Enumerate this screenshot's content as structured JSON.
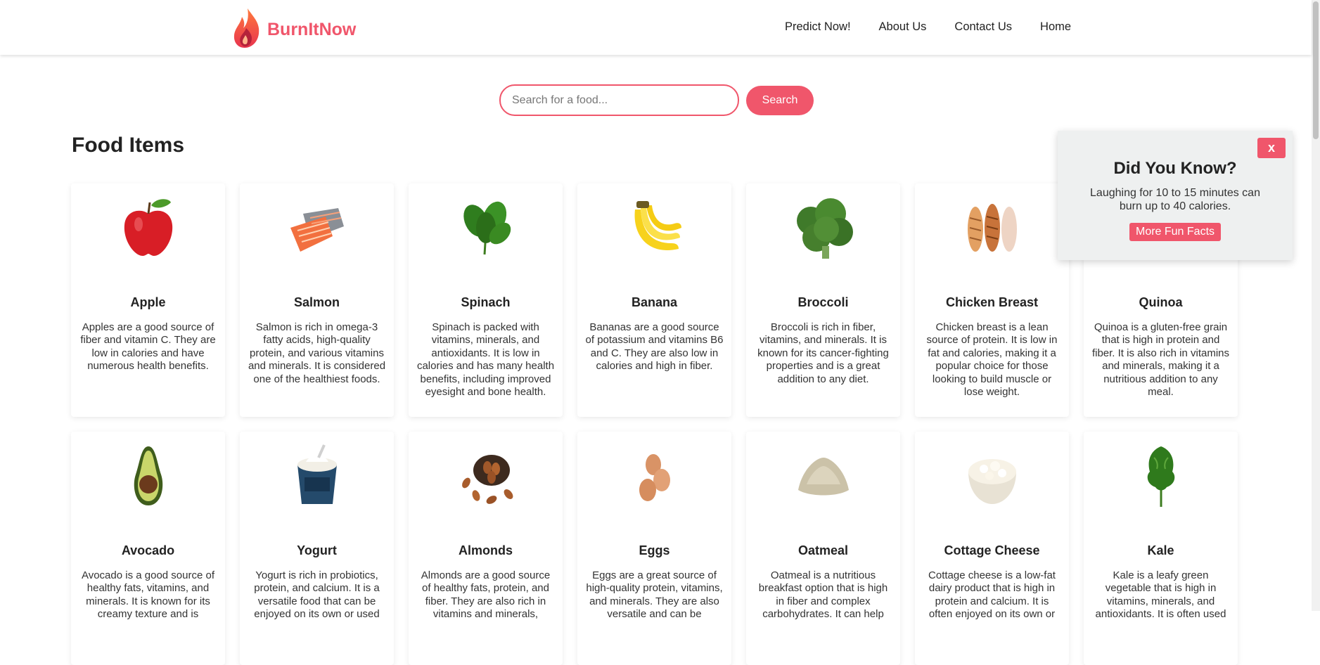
{
  "navbar": {
    "brand_name": "BurnItNow",
    "logo_icon": "flame-icon",
    "links": [
      "Predict Now!",
      "About Us",
      "Contact Us",
      "Home"
    ]
  },
  "search": {
    "placeholder": "Search for a food...",
    "value": "",
    "button_label": "Search"
  },
  "section_title": "Food Items",
  "foods": [
    {
      "name": "Apple",
      "icon": "apple-icon",
      "desc": "Apples are a good source of fiber and vitamin C. They are low in calories and have numerous health benefits."
    },
    {
      "name": "Salmon",
      "icon": "salmon-icon",
      "desc": "Salmon is rich in omega-3 fatty acids, high-quality protein, and various vitamins and minerals. It is considered one of the healthiest foods."
    },
    {
      "name": "Spinach",
      "icon": "spinach-icon",
      "desc": "Spinach is packed with vitamins, minerals, and antioxidants. It is low in calories and has many health benefits, including improved eyesight and bone health."
    },
    {
      "name": "Banana",
      "icon": "banana-icon",
      "desc": "Bananas are a good source of potassium and vitamins B6 and C. They are also low in calories and high in fiber."
    },
    {
      "name": "Broccoli",
      "icon": "broccoli-icon",
      "desc": "Broccoli is rich in fiber, vitamins, and minerals. It is known for its cancer-fighting properties and is a great addition to any diet."
    },
    {
      "name": "Chicken Breast",
      "icon": "chicken-breast-icon",
      "desc": "Chicken breast is a lean source of protein. It is low in fat and calories, making it a popular choice for those looking to build muscle or lose weight."
    },
    {
      "name": "Quinoa",
      "icon": "quinoa-icon",
      "desc": "Quinoa is a gluten-free grain that is high in protein and fiber. It is also rich in vitamins and minerals, making it a nutritious addition to any meal."
    },
    {
      "name": "Avocado",
      "icon": "avocado-icon",
      "desc": "Avocado is a good source of healthy fats, vitamins, and minerals. It is known for its creamy texture and is"
    },
    {
      "name": "Yogurt",
      "icon": "yogurt-icon",
      "desc": "Yogurt is rich in probiotics, protein, and calcium. It is a versatile food that can be enjoyed on its own or used"
    },
    {
      "name": "Almonds",
      "icon": "almonds-icon",
      "desc": "Almonds are a good source of healthy fats, protein, and fiber. They are also rich in vitamins and minerals,"
    },
    {
      "name": "Eggs",
      "icon": "eggs-icon",
      "desc": "Eggs are a great source of high-quality protein, vitamins, and minerals. They are also versatile and can be"
    },
    {
      "name": "Oatmeal",
      "icon": "oatmeal-icon",
      "desc": "Oatmeal is a nutritious breakfast option that is high in fiber and complex carbohydrates. It can help"
    },
    {
      "name": "Cottage Cheese",
      "icon": "cottage-cheese-icon",
      "desc": "Cottage cheese is a low-fat dairy product that is high in protein and calcium. It is often enjoyed on its own or"
    },
    {
      "name": "Kale",
      "icon": "kale-icon",
      "desc": "Kale is a leafy green vegetable that is high in vitamins, minerals, and antioxidants. It is often used"
    }
  ],
  "fact": {
    "close_label": "x",
    "title": "Did You Know?",
    "text": "Laughing for 10 to 15 minutes can burn up to 40 calories.",
    "button_label": "More Fun Facts"
  },
  "colors": {
    "accent": "#f0566b"
  }
}
